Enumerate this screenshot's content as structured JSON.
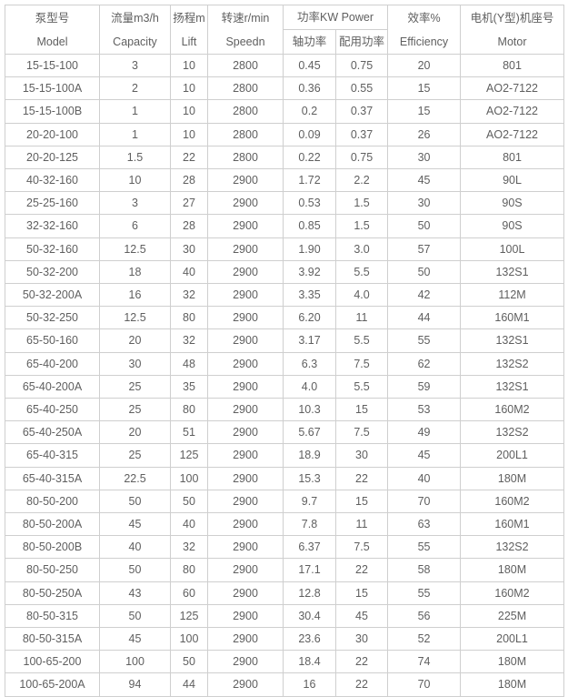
{
  "table": {
    "header": {
      "model": {
        "cn": "泵型号",
        "en": "Model"
      },
      "capacity": {
        "cn": "流量m3/h",
        "en": "Capacity"
      },
      "lift": {
        "cn": "扬程m",
        "en": "Lift"
      },
      "speed": {
        "cn": "转速r/min",
        "en": "Speedn"
      },
      "power_group": "功率KW Power",
      "shaft_power": "轴功率",
      "rated_power": "配用功率",
      "efficiency": {
        "cn": "效率%",
        "en": "Efficiency"
      },
      "motor": {
        "cn": "电机(Y型)机座号",
        "en": "Motor"
      }
    },
    "columns": [
      "Model",
      "Capacity",
      "Lift",
      "Speedn",
      "轴功率",
      "配用功率",
      "Efficiency",
      "Motor"
    ],
    "rows": [
      {
        "model": "15-15-100",
        "capacity": "3",
        "lift": "10",
        "speed": "2800",
        "shaft": "0.45",
        "rated": "0.75",
        "eff": "20",
        "motor": "801"
      },
      {
        "model": "15-15-100A",
        "capacity": "2",
        "lift": "10",
        "speed": "2800",
        "shaft": "0.36",
        "rated": "0.55",
        "eff": "15",
        "motor": "AO2-7122"
      },
      {
        "model": "15-15-100B",
        "capacity": "1",
        "lift": "10",
        "speed": "2800",
        "shaft": "0.2",
        "rated": "0.37",
        "eff": "15",
        "motor": "AO2-7122"
      },
      {
        "model": "20-20-100",
        "capacity": "1",
        "lift": "10",
        "speed": "2800",
        "shaft": "0.09",
        "rated": "0.37",
        "eff": "26",
        "motor": "AO2-7122"
      },
      {
        "model": "20-20-125",
        "capacity": "1.5",
        "lift": "22",
        "speed": "2800",
        "shaft": "0.22",
        "rated": "0.75",
        "eff": "30",
        "motor": "801"
      },
      {
        "model": "40-32-160",
        "capacity": "10",
        "lift": "28",
        "speed": "2900",
        "shaft": "1.72",
        "rated": "2.2",
        "eff": "45",
        "motor": "90L"
      },
      {
        "model": "25-25-160",
        "capacity": "3",
        "lift": "27",
        "speed": "2900",
        "shaft": "0.53",
        "rated": "1.5",
        "eff": "30",
        "motor": "90S"
      },
      {
        "model": "32-32-160",
        "capacity": "6",
        "lift": "28",
        "speed": "2900",
        "shaft": "0.85",
        "rated": "1.5",
        "eff": "50",
        "motor": "90S"
      },
      {
        "model": "50-32-160",
        "capacity": "12.5",
        "lift": "30",
        "speed": "2900",
        "shaft": "1.90",
        "rated": "3.0",
        "eff": "57",
        "motor": "100L"
      },
      {
        "model": "50-32-200",
        "capacity": "18",
        "lift": "40",
        "speed": "2900",
        "shaft": "3.92",
        "rated": "5.5",
        "eff": "50",
        "motor": "132S1"
      },
      {
        "model": "50-32-200A",
        "capacity": "16",
        "lift": "32",
        "speed": "2900",
        "shaft": "3.35",
        "rated": "4.0",
        "eff": "42",
        "motor": "112M"
      },
      {
        "model": "50-32-250",
        "capacity": "12.5",
        "lift": "80",
        "speed": "2900",
        "shaft": "6.20",
        "rated": "11",
        "eff": "44",
        "motor": "160M1"
      },
      {
        "model": "65-50-160",
        "capacity": "20",
        "lift": "32",
        "speed": "2900",
        "shaft": "3.17",
        "rated": "5.5",
        "eff": "55",
        "motor": "132S1"
      },
      {
        "model": "65-40-200",
        "capacity": "30",
        "lift": "48",
        "speed": "2900",
        "shaft": "6.3",
        "rated": "7.5",
        "eff": "62",
        "motor": "132S2"
      },
      {
        "model": "65-40-200A",
        "capacity": "25",
        "lift": "35",
        "speed": "2900",
        "shaft": "4.0",
        "rated": "5.5",
        "eff": "59",
        "motor": "132S1"
      },
      {
        "model": "65-40-250",
        "capacity": "25",
        "lift": "80",
        "speed": "2900",
        "shaft": "10.3",
        "rated": "15",
        "eff": "53",
        "motor": "160M2"
      },
      {
        "model": "65-40-250A",
        "capacity": "20",
        "lift": "51",
        "speed": "2900",
        "shaft": "5.67",
        "rated": "7.5",
        "eff": "49",
        "motor": "132S2"
      },
      {
        "model": "65-40-315",
        "capacity": "25",
        "lift": "125",
        "speed": "2900",
        "shaft": "18.9",
        "rated": "30",
        "eff": "45",
        "motor": "200L1"
      },
      {
        "model": "65-40-315A",
        "capacity": "22.5",
        "lift": "100",
        "speed": "2900",
        "shaft": "15.3",
        "rated": "22",
        "eff": "40",
        "motor": "180M"
      },
      {
        "model": "80-50-200",
        "capacity": "50",
        "lift": "50",
        "speed": "2900",
        "shaft": "9.7",
        "rated": "15",
        "eff": "70",
        "motor": "160M2"
      },
      {
        "model": "80-50-200A",
        "capacity": "45",
        "lift": "40",
        "speed": "2900",
        "shaft": "7.8",
        "rated": "11",
        "eff": "63",
        "motor": "160M1"
      },
      {
        "model": "80-50-200B",
        "capacity": "40",
        "lift": "32",
        "speed": "2900",
        "shaft": "6.37",
        "rated": "7.5",
        "eff": "55",
        "motor": "132S2"
      },
      {
        "model": "80-50-250",
        "capacity": "50",
        "lift": "80",
        "speed": "2900",
        "shaft": "17.1",
        "rated": "22",
        "eff": "58",
        "motor": "180M"
      },
      {
        "model": "80-50-250A",
        "capacity": "43",
        "lift": "60",
        "speed": "2900",
        "shaft": "12.8",
        "rated": "15",
        "eff": "55",
        "motor": "160M2"
      },
      {
        "model": "80-50-315",
        "capacity": "50",
        "lift": "125",
        "speed": "2900",
        "shaft": "30.4",
        "rated": "45",
        "eff": "56",
        "motor": "225M"
      },
      {
        "model": "80-50-315A",
        "capacity": "45",
        "lift": "100",
        "speed": "2900",
        "shaft": "23.6",
        "rated": "30",
        "eff": "52",
        "motor": "200L1"
      },
      {
        "model": "100-65-200",
        "capacity": "100",
        "lift": "50",
        "speed": "2900",
        "shaft": "18.4",
        "rated": "22",
        "eff": "74",
        "motor": "180M"
      },
      {
        "model": "100-65-200A",
        "capacity": "94",
        "lift": "44",
        "speed": "2900",
        "shaft": "16",
        "rated": "22",
        "eff": "70",
        "motor": "180M"
      }
    ]
  },
  "style": {
    "text_color": "#5f5f5f",
    "border_color": "#cfcfcf",
    "background": "#ffffff"
  }
}
